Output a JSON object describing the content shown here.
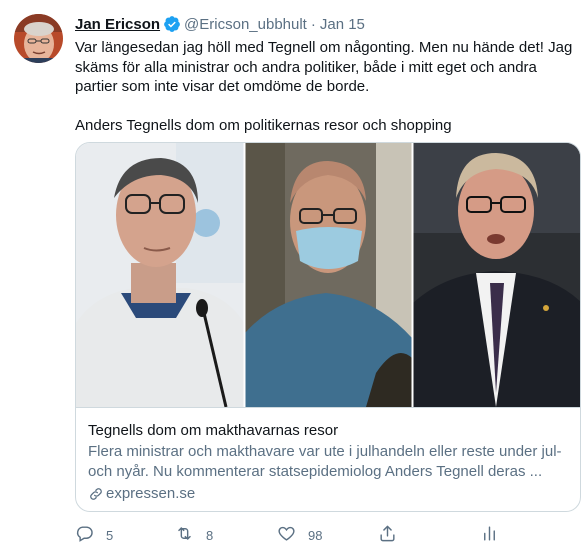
{
  "tweet": {
    "author_name": "Jan Ericson",
    "handle": "@Ericson_ubbhult",
    "separator": "·",
    "time": "Jan 15",
    "text_para1": "Var längesedan jag höll med Tegnell om någonting. Men nu hände det! Jag skäms för alla ministrar och andra politiker, både i mitt eget och andra partier som inte visar det omdöme de borde.",
    "text_para2": "Anders Tegnells dom om politikernas resor och shopping"
  },
  "card": {
    "title": "Tegnells dom om makthavarnas resor",
    "description": "Flera ministrar och makthavare var ute i julhandeln eller reste under jul- och nyår. Nu kommenterar statsepidemiolog Anders Tegnell deras ...",
    "domain": "expressen.se"
  },
  "actions": {
    "replies": "5",
    "retweets": "8",
    "likes": "98"
  },
  "icons": {
    "verified": "verified-badge-icon",
    "reply": "reply-icon",
    "retweet": "retweet-icon",
    "like": "heart-icon",
    "share": "share-icon",
    "analytics": "analytics-icon",
    "link": "link-icon"
  },
  "colors": {
    "accent": "#1da1f2",
    "secondary_text": "#5b7083",
    "border": "#cfd9de"
  }
}
